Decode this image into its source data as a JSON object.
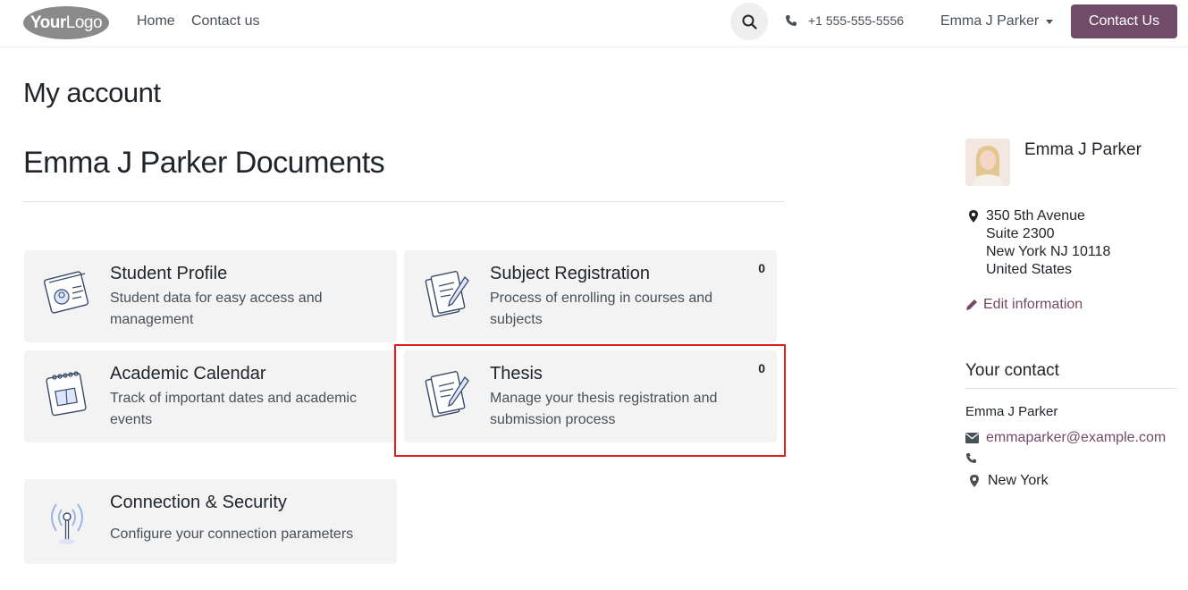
{
  "header": {
    "logo": {
      "bold": "Your",
      "regular": "Logo"
    },
    "nav": [
      {
        "label": "Home"
      },
      {
        "label": "Contact us"
      }
    ],
    "phone": "+1 555-555-5556",
    "user": "Emma J Parker",
    "cta": "Contact Us"
  },
  "main": {
    "page_title": "My account",
    "docs_title": "Emma J Parker Documents",
    "cards": [
      {
        "title": "Student Profile",
        "desc": "Student data for easy access and management",
        "count": "",
        "icon": "student-profile-icon"
      },
      {
        "title": "Subject Registration",
        "desc": "Process of enrolling in courses and subjects",
        "count": "0",
        "icon": "document-pen-icon"
      },
      {
        "title": "Academic Calendar",
        "desc": "Track of important dates and academic events",
        "count": "",
        "icon": "calendar-icon"
      },
      {
        "title": "Thesis",
        "desc": "Manage your thesis registration and submission process",
        "count": "0",
        "icon": "document-pen-icon"
      },
      {
        "title": "Connection & Security",
        "desc": "Configure your connection parameters",
        "count": "",
        "icon": "antenna-icon"
      }
    ]
  },
  "sidebar": {
    "name": "Emma J Parker",
    "address": [
      "350 5th Avenue",
      "Suite 2300",
      "New York NJ 10118",
      "United States"
    ],
    "edit": "Edit information",
    "contact_heading": "Your contact",
    "contact_name": "Emma J Parker",
    "contact_email": "emmaparker@example.com",
    "contact_phone": "",
    "contact_city": "New York"
  },
  "colors": {
    "accent": "#714b67",
    "highlight": "#e41b1b",
    "card_bg": "#f3f3f3"
  }
}
